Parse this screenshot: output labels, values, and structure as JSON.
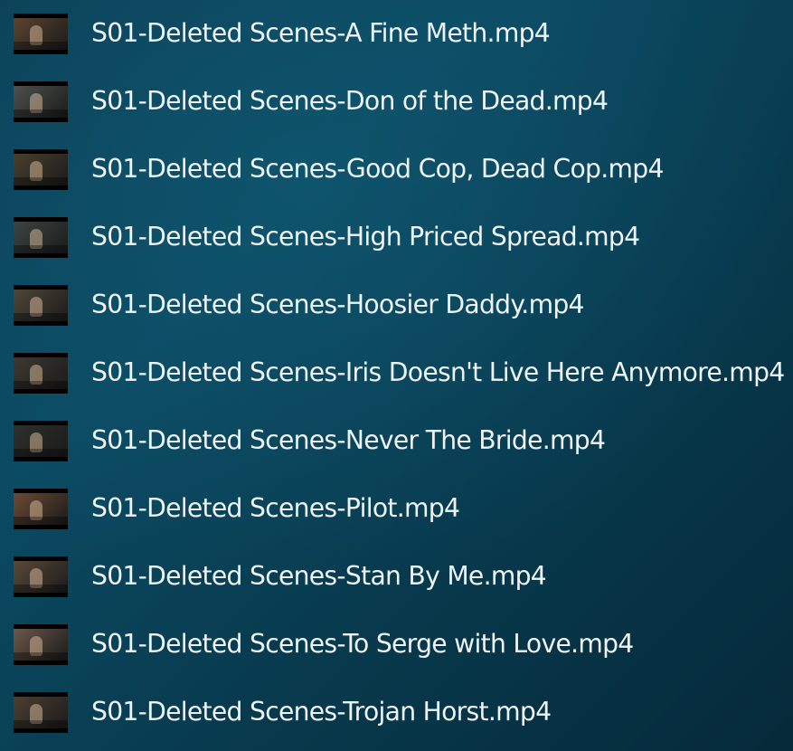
{
  "files": [
    {
      "name": "S01-Deleted Scenes-A Fine Meth.mp4",
      "thumb_color": "#5c4430"
    },
    {
      "name": "S01-Deleted Scenes-Don of the Dead.mp4",
      "thumb_color": "#4d524e"
    },
    {
      "name": "S01-Deleted Scenes-Good Cop, Dead Cop.mp4",
      "thumb_color": "#4a3f2d"
    },
    {
      "name": "S01-Deleted Scenes-High Priced Spread.mp4",
      "thumb_color": "#3b4541"
    },
    {
      "name": "S01-Deleted Scenes-Hoosier Daddy.mp4",
      "thumb_color": "#4f4638"
    },
    {
      "name": "S01-Deleted Scenes-Iris Doesn't Live Here Anymore.mp4",
      "thumb_color": "#3e3931"
    },
    {
      "name": "S01-Deleted Scenes-Never The Bride.mp4",
      "thumb_color": "#2e302c"
    },
    {
      "name": "S01-Deleted Scenes-Pilot.mp4",
      "thumb_color": "#6c4a33"
    },
    {
      "name": "S01-Deleted Scenes-Stan By Me.mp4",
      "thumb_color": "#5a4a39"
    },
    {
      "name": "S01-Deleted Scenes-To Serge with Love.mp4",
      "thumb_color": "#6d5749"
    },
    {
      "name": "S01-Deleted Scenes-Trojan Horst.mp4",
      "thumb_color": "#4c4032"
    }
  ]
}
